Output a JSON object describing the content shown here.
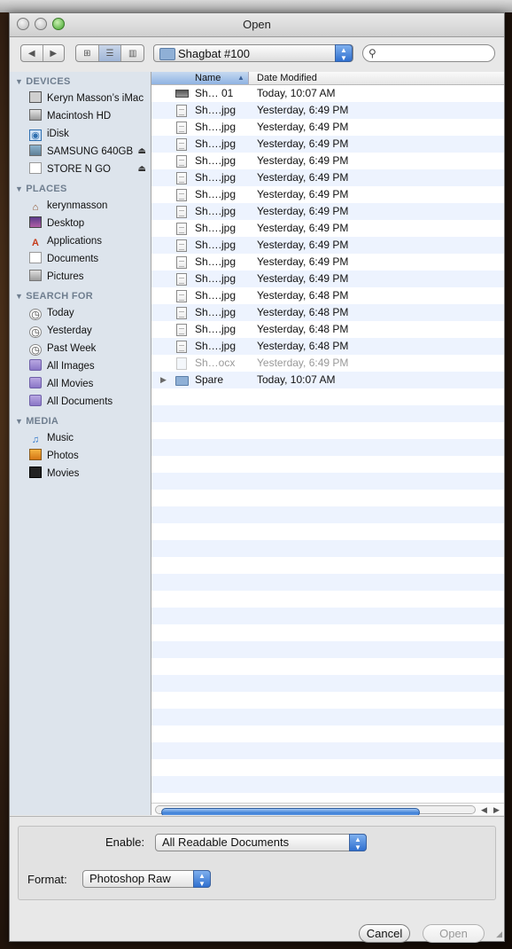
{
  "window": {
    "title": "Open"
  },
  "toolbar": {
    "back_icon": "◀",
    "forward_icon": "▶",
    "view_icons": [
      "⊞",
      "☰",
      "▥"
    ],
    "path_label": "Shagbat #100",
    "search_placeholder": ""
  },
  "sidebar": {
    "sections": [
      {
        "title": "DEVICES",
        "items": [
          {
            "label": "Keryn Masson’s iMac",
            "icon": "imac-icon"
          },
          {
            "label": "Macintosh HD",
            "icon": "hard-drive-icon"
          },
          {
            "label": "iDisk",
            "icon": "idisk-icon"
          },
          {
            "label": "SAMSUNG 640GB",
            "icon": "external-drive-icon",
            "eject": "⏏"
          },
          {
            "label": "STORE N GO",
            "icon": "usb-drive-icon",
            "eject": "⏏"
          }
        ]
      },
      {
        "title": "PLACES",
        "items": [
          {
            "label": "kerynmasson",
            "icon": "home-icon"
          },
          {
            "label": "Desktop",
            "icon": "desktop-icon"
          },
          {
            "label": "Applications",
            "icon": "applications-icon"
          },
          {
            "label": "Documents",
            "icon": "documents-icon"
          },
          {
            "label": "Pictures",
            "icon": "pictures-icon"
          }
        ]
      },
      {
        "title": "SEARCH FOR",
        "items": [
          {
            "label": "Today",
            "icon": "clock-icon"
          },
          {
            "label": "Yesterday",
            "icon": "clock-icon"
          },
          {
            "label": "Past Week",
            "icon": "clock-icon"
          },
          {
            "label": "All Images",
            "icon": "smart-folder-icon"
          },
          {
            "label": "All Movies",
            "icon": "smart-folder-icon"
          },
          {
            "label": "All Documents",
            "icon": "smart-folder-icon"
          }
        ]
      },
      {
        "title": "MEDIA",
        "items": [
          {
            "label": "Music",
            "icon": "music-icon"
          },
          {
            "label": "Photos",
            "icon": "photos-icon"
          },
          {
            "label": "Movies",
            "icon": "movies-icon"
          }
        ]
      }
    ]
  },
  "file_list": {
    "columns": {
      "name": "Name",
      "date": "Date Modified"
    },
    "sort_indicator": "▲",
    "rows": [
      {
        "name": "Sh… 01",
        "date": "Today, 10:07 AM",
        "icon": "alias",
        "disabled": false,
        "expandable": false
      },
      {
        "name": "Sh….jpg",
        "date": "Yesterday, 6:49 PM",
        "icon": "doc",
        "disabled": false,
        "expandable": false
      },
      {
        "name": "Sh….jpg",
        "date": "Yesterday, 6:49 PM",
        "icon": "doc",
        "disabled": false,
        "expandable": false
      },
      {
        "name": "Sh….jpg",
        "date": "Yesterday, 6:49 PM",
        "icon": "doc",
        "disabled": false,
        "expandable": false
      },
      {
        "name": "Sh….jpg",
        "date": "Yesterday, 6:49 PM",
        "icon": "doc",
        "disabled": false,
        "expandable": false
      },
      {
        "name": "Sh….jpg",
        "date": "Yesterday, 6:49 PM",
        "icon": "doc",
        "disabled": false,
        "expandable": false
      },
      {
        "name": "Sh….jpg",
        "date": "Yesterday, 6:49 PM",
        "icon": "doc",
        "disabled": false,
        "expandable": false
      },
      {
        "name": "Sh….jpg",
        "date": "Yesterday, 6:49 PM",
        "icon": "doc",
        "disabled": false,
        "expandable": false
      },
      {
        "name": "Sh….jpg",
        "date": "Yesterday, 6:49 PM",
        "icon": "doc",
        "disabled": false,
        "expandable": false
      },
      {
        "name": "Sh….jpg",
        "date": "Yesterday, 6:49 PM",
        "icon": "doc",
        "disabled": false,
        "expandable": false
      },
      {
        "name": "Sh….jpg",
        "date": "Yesterday, 6:49 PM",
        "icon": "doc",
        "disabled": false,
        "expandable": false
      },
      {
        "name": "Sh….jpg",
        "date": "Yesterday, 6:49 PM",
        "icon": "doc",
        "disabled": false,
        "expandable": false
      },
      {
        "name": "Sh….jpg",
        "date": "Yesterday, 6:48 PM",
        "icon": "doc",
        "disabled": false,
        "expandable": false
      },
      {
        "name": "Sh….jpg",
        "date": "Yesterday, 6:48 PM",
        "icon": "doc",
        "disabled": false,
        "expandable": false
      },
      {
        "name": "Sh….jpg",
        "date": "Yesterday, 6:48 PM",
        "icon": "doc",
        "disabled": false,
        "expandable": false
      },
      {
        "name": "Sh….jpg",
        "date": "Yesterday, 6:48 PM",
        "icon": "doc",
        "disabled": false,
        "expandable": false
      },
      {
        "name": "Sh…ocx",
        "date": "Yesterday, 6:49 PM",
        "icon": "docx",
        "disabled": true,
        "expandable": false
      },
      {
        "name": "Spare",
        "date": "Today, 10:07 AM",
        "icon": "folder",
        "disabled": false,
        "expandable": true
      }
    ]
  },
  "options": {
    "enable_label": "Enable:",
    "enable_value": "All Readable Documents",
    "format_label": "Format:",
    "format_value": "Photoshop Raw"
  },
  "buttons": {
    "cancel": "Cancel",
    "open": "Open"
  },
  "colors": {
    "selection_blue": "#3d7fd7",
    "row_stripe": "#edf3fe",
    "sidebar_bg": "#dde4ec"
  }
}
